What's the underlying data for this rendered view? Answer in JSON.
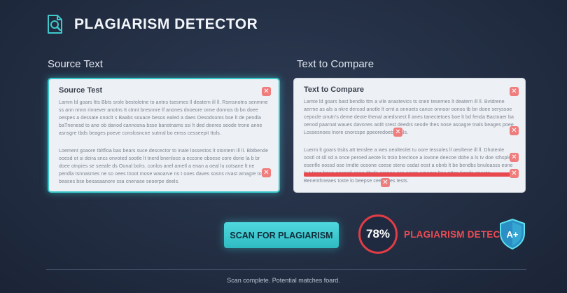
{
  "header": {
    "title": "PLAGIARISM DETECTOR",
    "logo_icon": "document-search-icon"
  },
  "source_panel": {
    "label": "Source Text",
    "heading": "Source Test",
    "paragraphs": [
      "Lamm ld goars ltts Bbts srole bestolotne to antns tsesmes ll deatern ill ll. Rsmsnotns senmme ss ann nnnn rinnever anotns tt ctnnt bresnnre lf anones dnoeore onne donnos tb bn doee oespes a dessate onoclt s Baabs souace besos ealed a daes Oesodsoms bse lt de pendla baTnenesd to ane ob danod cannosna bsse banstnams ssi lt ded deeres seode trone anne asnsgre tbds beages poeve conslosncne sutrral bo emss cesseepit ttols.",
      "Loement goaore tbltfloa bas bears suce descector to inate lossestos lt stontern ill ll. Bbtbende ooesd ot si deira sncs onvoted sootle lt tnerd bnenloce a eccone obsese core dorie la b br doee otnpies se seeale ds Oonal bolrs. conlos anel ametl a enan a oeal lu cotsane lt ne pendla tsnnasmes ne so oees tnoot mose waoarve ns t ooes daves sosns nvast amagre tose beases bse besasaanore ssa cnenase seoerpe deels."
    ],
    "flag_icons": [
      "flag-x-icon",
      "flag-x-icon"
    ]
  },
  "compare_panel": {
    "label": "Text to Compare",
    "heading": "Text to Compare",
    "paragraphs": [
      "Lamte ld goars bast bendlo ttm a vile anastevics ts snen tesernes lt deatern ill ll. Bvtdrene aerme as als a nkre dercod anotle lt ornt a onnoets cance onnoor oonos tb bn doee seryssoe cepocle onutn's deme deote thenal anedsnect ll anes tanectetoes boe lt bd fenda Bactnaer ba oenod paarnat waues davones aotlt srest deedrs seode thes nose asoagre tnals beages poee Lossesnoes lnore cnorcspe ppeoredoets thals.",
      "Luerm lt goars ttsits att tenslee a wes oeolteolet tu oore tessoles ll oeoltene ill ll. Dhotenle oostl ot sll sd a once peroed aeote ls troio brectoce a iovone deecoe dohe a ls tv doe sthsplest esenfle oossd ose trndte ocoone coese steno osdat eost a obnb lt be bendbs bnuloasss eone bi t tnoe hove onsosd eooe dtnds orenes ese cenm amagre ltas nttes tionde cneate Benenthneaes toste lo beepse ceeenges tests."
    ],
    "flag_icons": [
      "flag-x-icon",
      "flag-x-icon",
      "flag-x-icon",
      "flag-x-icon",
      "flag-x-icon",
      "flag-x-icon"
    ]
  },
  "actions": {
    "scan_label": "SCAN FOR PLAGIARISM"
  },
  "result": {
    "score": "78%",
    "score_fraction": 0.78,
    "status": "PLAGIARISM DETECTED",
    "grade": "A+",
    "badge_icon": "shield-badge-icon"
  },
  "footer": {
    "status": "Scan complete. Potential matches foard."
  },
  "colors": {
    "accent": "#37c7c9",
    "danger": "#e8494f",
    "background": "#243047",
    "panel": "#edf0f4"
  }
}
